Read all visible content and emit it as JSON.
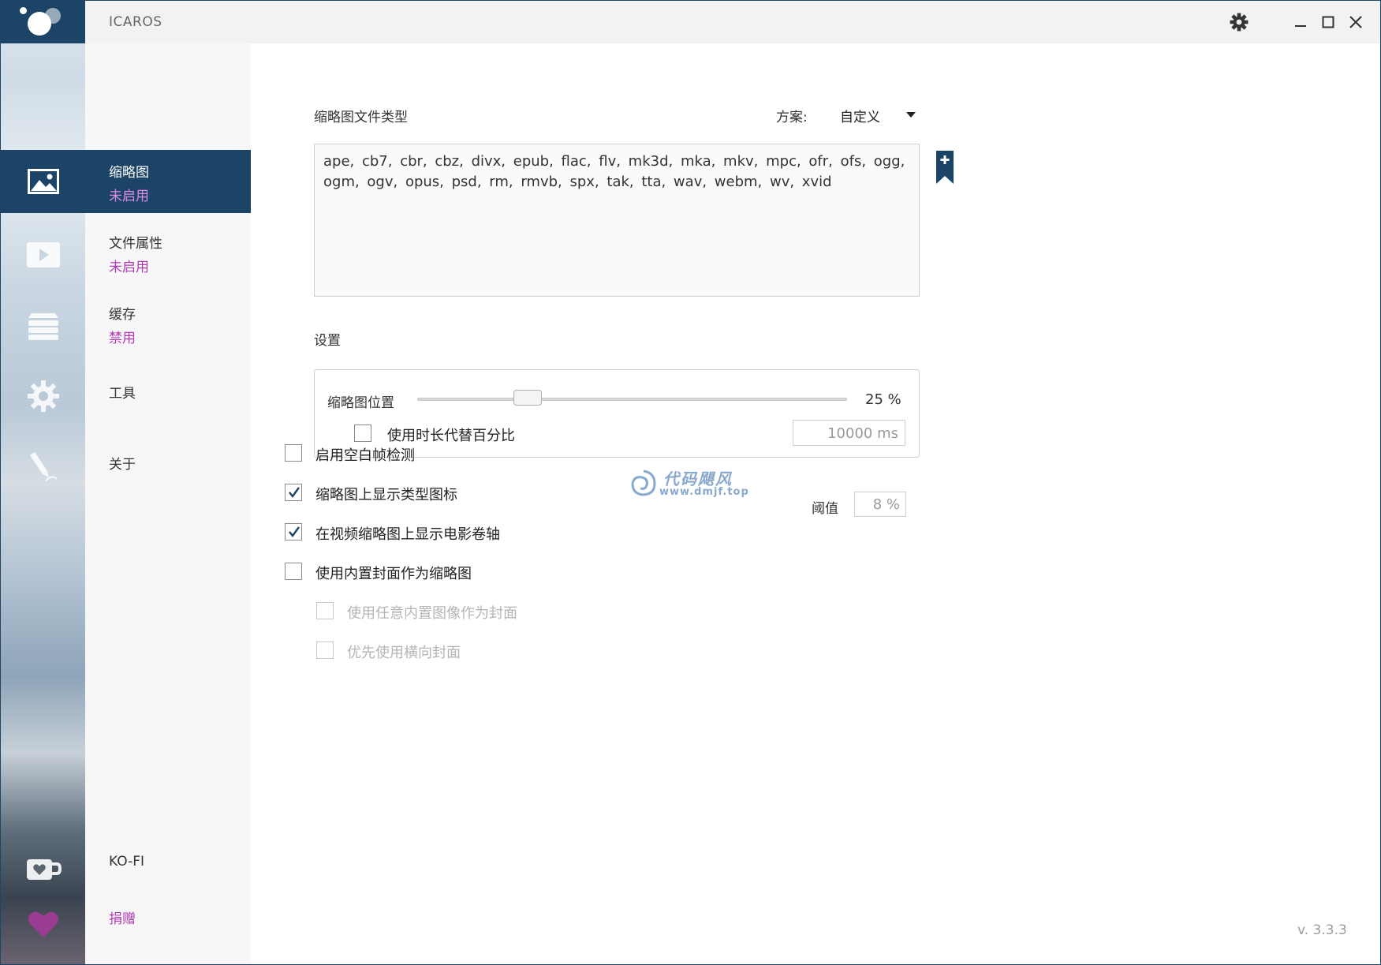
{
  "app": {
    "title": "ICAROS",
    "version": "v. 3.3.3"
  },
  "colors": {
    "accent": "#1b4466",
    "status_magenta": "#b23bb5"
  },
  "strip_icons": [
    {
      "name": "thumbnail-icon"
    },
    {
      "name": "video-icon"
    },
    {
      "name": "stack-icon"
    },
    {
      "name": "gear-icon"
    },
    {
      "name": "tools-icon"
    },
    {
      "name": "kofi-cup-icon"
    },
    {
      "name": "heart-icon"
    }
  ],
  "nav": {
    "items": [
      {
        "label": "缩略图",
        "status": "未启用"
      },
      {
        "label": "文件属性",
        "status": "未启用"
      },
      {
        "label": "缓存",
        "status": "禁用"
      },
      {
        "label": "工具",
        "status": ""
      },
      {
        "label": "关于",
        "status": ""
      }
    ],
    "kofi": "KO-FI",
    "donate": "捐赠"
  },
  "main": {
    "filetypes_title": "缩略图文件类型",
    "scheme_label": "方案:",
    "scheme_value": "自定义",
    "filetypes_line1": "ape, cb7, cbr, cbz, divx, epub, flac, flv, mk3d, mka, mkv, mpc, ofr, ofs, ogg,",
    "filetypes_line2": "ogm, ogv, opus, psd, rm, rmvb, spx, tak, tta, wav, webm, wv, xvid",
    "settings_title": "设置",
    "slider_label": "缩略图位置",
    "slider_value_text": "25 %",
    "slider_fraction": 0.25,
    "duration_checkbox": {
      "label": "使用时长代替百分比",
      "checked": false
    },
    "duration_value": "10000 ms",
    "threshold_label": "阈值",
    "threshold_value": "8 %",
    "options": [
      {
        "label": "启用空白帧检测",
        "checked": false,
        "disabled": false
      },
      {
        "label": "缩略图上显示类型图标",
        "checked": true,
        "disabled": false
      },
      {
        "label": "在视频缩略图上显示电影卷轴",
        "checked": true,
        "disabled": false
      },
      {
        "label": "使用内置封面作为缩略图",
        "checked": false,
        "disabled": false
      },
      {
        "label": "使用任意内置图像作为封面",
        "checked": false,
        "disabled": true
      },
      {
        "label": "优先使用横向封面",
        "checked": false,
        "disabled": true
      }
    ]
  },
  "watermark": {
    "name": "代码飓风",
    "url": "www.dmjf.top"
  }
}
